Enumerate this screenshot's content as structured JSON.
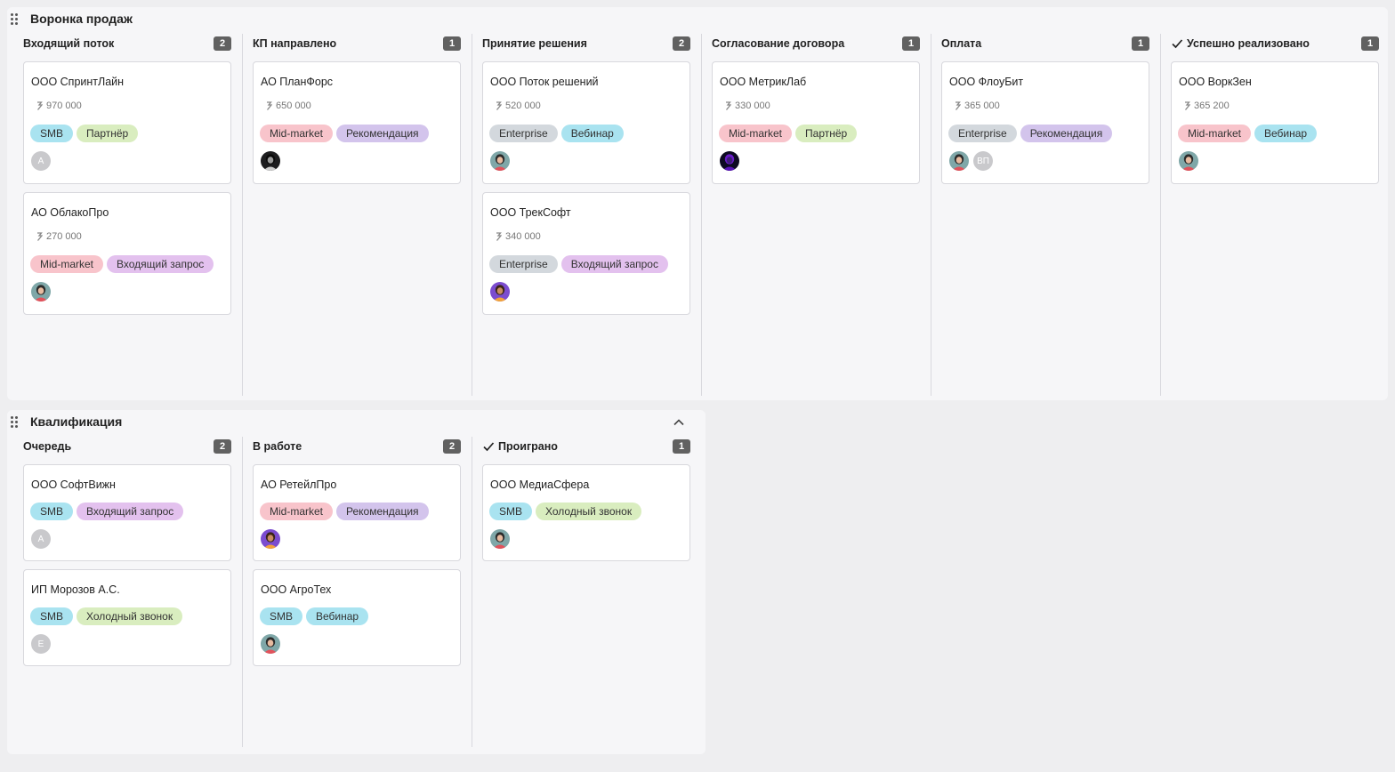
{
  "colors": {
    "tag_smb": "#a9e3f0",
    "tag_partner": "#d9edbf",
    "tag_midmarket": "#f8c4cb",
    "tag_enterprise": "#d3d8dd",
    "tag_referral": "#d3c4ec",
    "tag_webinar": "#a9e3f0",
    "tag_inbound": "#e3c1ee",
    "tag_cold": "#d9edbf",
    "count_badge": "#616161"
  },
  "boards": [
    {
      "title": "Воронка продаж",
      "columns": [
        {
          "title": "Входящий поток",
          "count": "2",
          "check": false,
          "cards": [
            {
              "name": "ООО СпринтЛайн",
              "amount": "970 000",
              "tags": [
                {
                  "label": "SMB",
                  "kind": "smb"
                },
                {
                  "label": "Партнёр",
                  "kind": "partner"
                }
              ],
              "avatars": [
                {
                  "type": "initials",
                  "text": "А"
                }
              ]
            },
            {
              "name": "АО ОблакоПро",
              "amount": "270 000",
              "tags": [
                {
                  "label": "Mid-market",
                  "kind": "midmarket"
                },
                {
                  "label": "Входящий запрос",
                  "kind": "inbound"
                }
              ],
              "avatars": [
                {
                  "type": "photo",
                  "icon": "woman-avatar-icon"
                }
              ]
            }
          ]
        },
        {
          "title": "КП направлено",
          "count": "1",
          "check": false,
          "cards": [
            {
              "name": "АО ПланФорс",
              "amount": "650 000",
              "tags": [
                {
                  "label": "Mid-market",
                  "kind": "midmarket"
                },
                {
                  "label": "Рекомендация",
                  "kind": "referral"
                }
              ],
              "avatars": [
                {
                  "type": "photo",
                  "icon": "dark-avatar-icon"
                }
              ]
            }
          ]
        },
        {
          "title": "Принятие решения",
          "count": "2",
          "check": false,
          "cards": [
            {
              "name": "ООО Поток решений",
              "amount": "520 000",
              "tags": [
                {
                  "label": "Enterprise",
                  "kind": "enterprise"
                },
                {
                  "label": "Вебинар",
                  "kind": "webinar"
                }
              ],
              "avatars": [
                {
                  "type": "photo",
                  "icon": "woman-avatar-icon"
                }
              ]
            },
            {
              "name": "ООО ТрекСофт",
              "amount": "340 000",
              "tags": [
                {
                  "label": "Enterprise",
                  "kind": "enterprise"
                },
                {
                  "label": "Входящий запрос",
                  "kind": "inbound"
                }
              ],
              "avatars": [
                {
                  "type": "photo",
                  "icon": "purple-avatar-icon"
                }
              ]
            }
          ]
        },
        {
          "title": "Согласование договора",
          "count": "1",
          "check": false,
          "cards": [
            {
              "name": "ООО МетрикЛаб",
              "amount": "330 000",
              "tags": [
                {
                  "label": "Mid-market",
                  "kind": "midmarket"
                },
                {
                  "label": "Партнёр",
                  "kind": "partner"
                }
              ],
              "avatars": [
                {
                  "type": "photo",
                  "icon": "night-avatar-icon"
                }
              ]
            }
          ]
        },
        {
          "title": "Оплата",
          "count": "1",
          "check": false,
          "cards": [
            {
              "name": "ООО ФлоуБит",
              "amount": "365 000",
              "tags": [
                {
                  "label": "Enterprise",
                  "kind": "enterprise"
                },
                {
                  "label": "Рекомендация",
                  "kind": "referral"
                }
              ],
              "avatars": [
                {
                  "type": "photo",
                  "icon": "woman-avatar-icon"
                },
                {
                  "type": "initials",
                  "text": "ВП"
                }
              ]
            }
          ]
        },
        {
          "title": "Успешно реализовано",
          "count": "1",
          "check": true,
          "cards": [
            {
              "name": "ООО ВоркЗен",
              "amount": "365 200",
              "tags": [
                {
                  "label": "Mid-market",
                  "kind": "midmarket"
                },
                {
                  "label": "Вебинар",
                  "kind": "webinar"
                }
              ],
              "avatars": [
                {
                  "type": "photo",
                  "icon": "woman-avatar-icon"
                }
              ]
            }
          ]
        }
      ]
    },
    {
      "title": "Квалификация",
      "collapsible": true,
      "columns": [
        {
          "title": "Очередь",
          "count": "2",
          "check": false,
          "cards": [
            {
              "name": "ООО СофтВижн",
              "amount": null,
              "tags": [
                {
                  "label": "SMB",
                  "kind": "smb"
                },
                {
                  "label": "Входящий запрос",
                  "kind": "inbound"
                }
              ],
              "avatars": [
                {
                  "type": "initials",
                  "text": "А"
                }
              ]
            },
            {
              "name": "ИП Морозов А.С.",
              "amount": null,
              "tags": [
                {
                  "label": "SMB",
                  "kind": "smb"
                },
                {
                  "label": "Холодный звонок",
                  "kind": "cold"
                }
              ],
              "avatars": [
                {
                  "type": "initials",
                  "text": "Е"
                }
              ]
            }
          ]
        },
        {
          "title": "В работе",
          "count": "2",
          "check": false,
          "cards": [
            {
              "name": "АО РетейлПро",
              "amount": null,
              "tags": [
                {
                  "label": "Mid-market",
                  "kind": "midmarket"
                },
                {
                  "label": "Рекомендация",
                  "kind": "referral"
                }
              ],
              "avatars": [
                {
                  "type": "photo",
                  "icon": "purple-avatar-icon"
                }
              ]
            },
            {
              "name": "ООО АгроТех",
              "amount": null,
              "tags": [
                {
                  "label": "SMB",
                  "kind": "smb"
                },
                {
                  "label": "Вебинар",
                  "kind": "webinar"
                }
              ],
              "avatars": [
                {
                  "type": "photo",
                  "icon": "woman-avatar-icon"
                }
              ]
            }
          ]
        },
        {
          "title": "Проиграно",
          "count": "1",
          "check": true,
          "cards": [
            {
              "name": "ООО МедиаСфера",
              "amount": null,
              "tags": [
                {
                  "label": "SMB",
                  "kind": "smb"
                },
                {
                  "label": "Холодный звонок",
                  "kind": "cold"
                }
              ],
              "avatars": [
                {
                  "type": "photo",
                  "icon": "woman-avatar-icon"
                }
              ]
            }
          ]
        }
      ]
    }
  ]
}
